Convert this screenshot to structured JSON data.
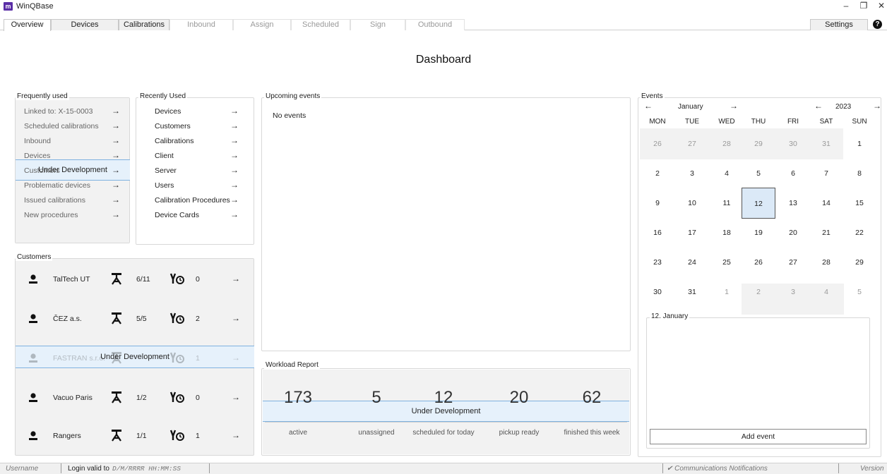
{
  "app": {
    "logo": "m",
    "title": "WinQBase"
  },
  "window_controls": {
    "minimize": "–",
    "restore": "❐",
    "close": "✕"
  },
  "tabs": [
    "Overview",
    "Devices",
    "Calibrations",
    "Inbound",
    "Assign",
    "Scheduled",
    "Sign",
    "Outbound"
  ],
  "settings_label": "Settings",
  "help_label": "?",
  "page_title": "Dashboard",
  "arrow": "→",
  "frequently_used": {
    "title": "Frequently used",
    "items": [
      "Linked to: X-15-0003",
      "Scheduled calibrations",
      "Inbound",
      "Devices",
      "Customers",
      "Problematic devices",
      "Issued calibrations",
      "New procedures"
    ]
  },
  "recently_used": {
    "title": "Recently Used",
    "items": [
      "Devices",
      "Customers",
      "Calibrations",
      "Client",
      "Server",
      "Users",
      "Calibration Procedures",
      "Device Cards"
    ]
  },
  "under_development": "Under Development",
  "upcoming": {
    "title": "Upcoming events",
    "empty": "No events"
  },
  "customers": {
    "title": "Customers",
    "rows": [
      {
        "name": "TalTech UT",
        "devices": "6/11",
        "calibrations": "0"
      },
      {
        "name": "ČEZ a.s.",
        "devices": "5/5",
        "calibrations": "2"
      },
      {
        "name": "FASTRAN s.r.o.",
        "devices": "",
        "calibrations": "1"
      },
      {
        "name": "Vacuo Paris",
        "devices": "1/2",
        "calibrations": "0"
      },
      {
        "name": "Rangers",
        "devices": "1/1",
        "calibrations": "1"
      }
    ]
  },
  "workload": {
    "title": "Workload Report",
    "values": [
      "173",
      "5",
      "12",
      "20",
      "62"
    ],
    "labels": [
      "active",
      "unassigned",
      "scheduled for today",
      "pickup ready",
      "finished this week"
    ]
  },
  "events": {
    "title": "Events",
    "prev": "←",
    "next": "→",
    "month": "January",
    "year": "2023",
    "weekdays": [
      "MON",
      "TUE",
      "WED",
      "THU",
      "FRI",
      "SAT",
      "SUN"
    ],
    "weeks": [
      [
        "26",
        "27",
        "28",
        "29",
        "30",
        "31",
        "1"
      ],
      [
        "2",
        "3",
        "4",
        "5",
        "6",
        "7",
        "8"
      ],
      [
        "9",
        "10",
        "11",
        "12",
        "13",
        "14",
        "15"
      ],
      [
        "16",
        "17",
        "18",
        "19",
        "20",
        "21",
        "22"
      ],
      [
        "23",
        "24",
        "25",
        "26",
        "27",
        "28",
        "29"
      ],
      [
        "30",
        "31",
        "1",
        "2",
        "3",
        "4",
        "5"
      ]
    ],
    "selected_day": "12",
    "day_panel_title": "12. January",
    "add_event": "Add event"
  },
  "status_bar": {
    "username": "Username",
    "login_label": "Login valid to",
    "login_value": "D/M/RRRR  HH:MM:SS",
    "notifications": "✔ Communications Notifications",
    "version": "Version"
  },
  "icons": [
    "person-icon",
    "device-icon",
    "calibration-icon",
    "arrow-right-icon",
    "arrow-left-icon",
    "help-icon",
    "check-icon"
  ]
}
